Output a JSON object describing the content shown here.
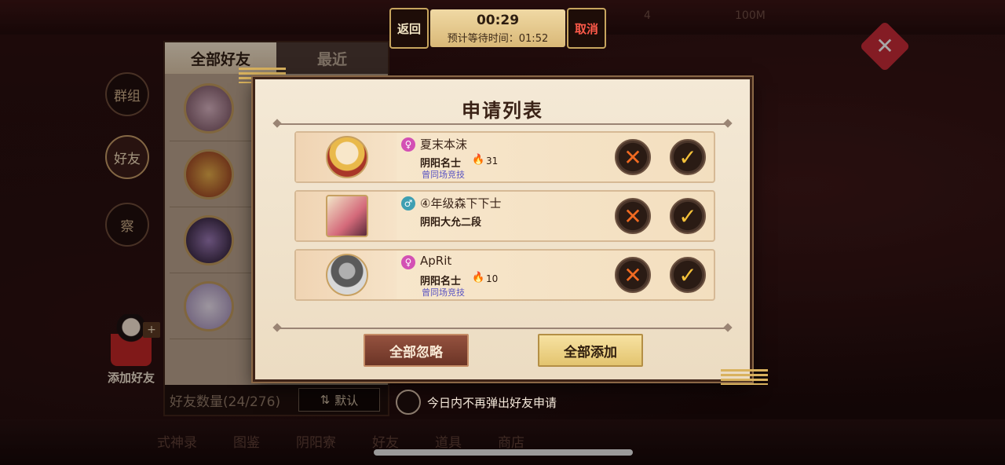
{
  "matchmaking": {
    "back_label": "返回",
    "cancel_label": "取消",
    "timer": "00:29",
    "estimated_wait": "预计等待时间：01:52"
  },
  "hud": {
    "score_a": "4",
    "score_b": "100M"
  },
  "categories": [
    {
      "label": "群组",
      "active": false
    },
    {
      "label": "好友",
      "active": true
    },
    {
      "label": "察",
      "active": false
    }
  ],
  "add_friend": {
    "label": "添加好友",
    "sign": "+"
  },
  "friend_panel": {
    "tabs": [
      "全部好友",
      "最近"
    ],
    "count_label": "好友数量(24/276)",
    "sort_label": "默认",
    "sort_icon": "⇅"
  },
  "modal": {
    "title": "申请列表",
    "requests": [
      {
        "name": "夏末本沫",
        "gender": "female",
        "gender_symbol": "♀",
        "rank": "阴阳名士",
        "score": "31",
        "note": "曾同场竞技",
        "avatar_color": "#e9b94a"
      },
      {
        "name": "④年级森下下士",
        "gender": "male",
        "gender_symbol": "♂",
        "rank": "阴阳大允二段",
        "score": "",
        "note": "",
        "avatar_color": "#d46a7a"
      },
      {
        "name": "ApRit",
        "gender": "female",
        "gender_symbol": "♀",
        "rank": "阴阳名士",
        "score": "10",
        "note": "曾同场竞技",
        "avatar_color": "#8c8c8c"
      }
    ],
    "reject_glyph": "✕",
    "accept_glyph": "✓",
    "flame_glyph": "🔥",
    "ignore_all_label": "全部忽略",
    "add_all_label": "全部添加"
  },
  "no_popup_label": "今日内不再弹出好友申请",
  "bottom_nav": [
    "式神录",
    "图鉴",
    "阴阳寮",
    "好友",
    "道具",
    "商店"
  ],
  "close_glyph": "✕",
  "colors": {
    "accent_red": "#c62a37",
    "accept_gold": "#f4c13a",
    "reject_orange": "#f06a22"
  }
}
